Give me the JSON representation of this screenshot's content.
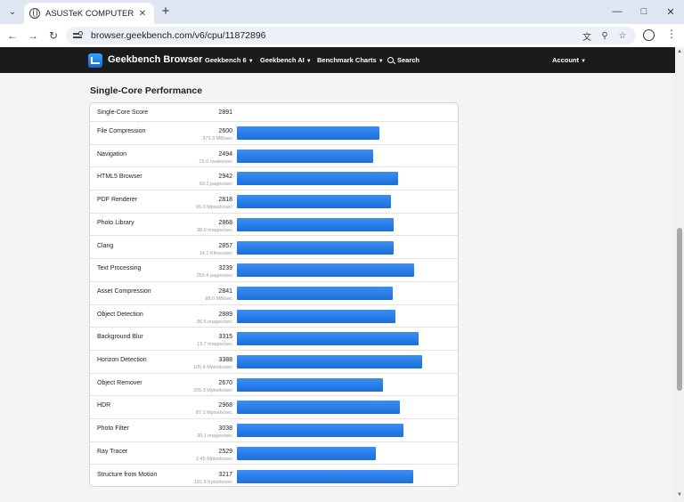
{
  "browser": {
    "tab_title": "ASUSTeK COMPUTER INC. NU",
    "url": "browser.geekbench.com/v6/cpu/11872896"
  },
  "navbar": {
    "brand": "Geekbench Browser",
    "items": [
      "Geekbench 6",
      "Geekbench AI",
      "Benchmark Charts"
    ],
    "search_label": "Search",
    "account_label": "Account"
  },
  "section": {
    "title": "Single-Core Performance"
  },
  "overall": {
    "name": "Single-Core Score",
    "score": "2891"
  },
  "benchmarks": [
    {
      "name": "File Compression",
      "score": "2600",
      "sub": "373.3 MB/sec",
      "value": 2600
    },
    {
      "name": "Navigation",
      "score": "2494",
      "sub": "15.0 routes/sec",
      "value": 2494
    },
    {
      "name": "HTML5 Browser",
      "score": "2942",
      "sub": "60.2 pages/sec",
      "value": 2942
    },
    {
      "name": "PDF Renderer",
      "score": "2818",
      "sub": "65.0 Mpixels/sec",
      "value": 2818
    },
    {
      "name": "Photo Library",
      "score": "2868",
      "sub": "38.9 images/sec",
      "value": 2868
    },
    {
      "name": "Clang",
      "score": "2857",
      "sub": "14.1 Klines/sec",
      "value": 2857
    },
    {
      "name": "Text Processing",
      "score": "3239",
      "sub": "259.4 pages/sec",
      "value": 3239
    },
    {
      "name": "Asset Compression",
      "score": "2841",
      "sub": "88.0 MB/sec",
      "value": 2841
    },
    {
      "name": "Object Detection",
      "score": "2889",
      "sub": "86.5 images/sec",
      "value": 2889
    },
    {
      "name": "Background Blur",
      "score": "3315",
      "sub": "13.7 images/sec",
      "value": 3315
    },
    {
      "name": "Horizon Detection",
      "score": "3388",
      "sub": "105.4 Mpixels/sec",
      "value": 3388
    },
    {
      "name": "Object Remover",
      "score": "2670",
      "sub": "205.3 Mpixels/sec",
      "value": 2670
    },
    {
      "name": "HDR",
      "score": "2968",
      "sub": "87.1 Mpixels/sec",
      "value": 2968
    },
    {
      "name": "Photo Filter",
      "score": "3038",
      "sub": "30.1 images/sec",
      "value": 3038
    },
    {
      "name": "Ray Tracer",
      "score": "2529",
      "sub": "2.45 Mpixels/sec",
      "value": 2529
    },
    {
      "name": "Structure from Motion",
      "score": "3217",
      "sub": "101.9 Kpixels/sec",
      "value": 3217
    }
  ],
  "bar_scale_max": 3900,
  "colors": {
    "bar": "#1c6fd8",
    "navbar": "#1b1b1b"
  }
}
